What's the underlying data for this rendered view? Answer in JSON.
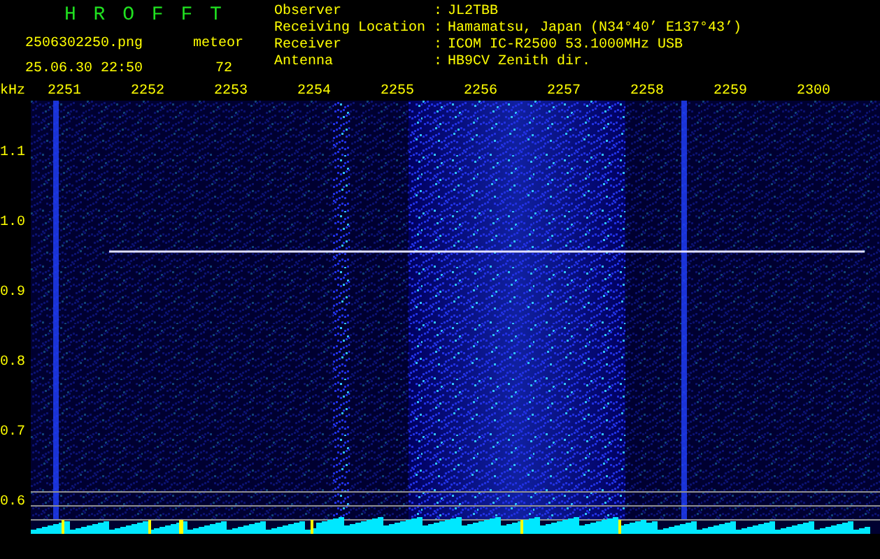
{
  "header": {
    "title": "H R O F F T",
    "filename": "2506302250.png",
    "datetime": "25.06.30 22:50",
    "count_label": "meteor",
    "count": "72"
  },
  "info": [
    {
      "label": "Observer",
      "separator": ":",
      "value": "JL2TBB"
    },
    {
      "label": "Receiving Location",
      "separator": ":",
      "value": "Hamamatsu, Japan (N34°40’ E137°43’)"
    },
    {
      "label": "Receiver",
      "separator": ":",
      "value": "ICOM IC-R2500 53.1000MHz USB"
    },
    {
      "label": "Antenna",
      "separator": ":",
      "value": "HB9CV Zenith dir."
    }
  ],
  "y_unit": "kHz",
  "x_labels": [
    "2251",
    "2252",
    "2253",
    "2254",
    "2255",
    "2256",
    "2257",
    "2258",
    "2259",
    "2300"
  ],
  "y_labels": [
    "1.1",
    "1.0",
    "0.9",
    "0.8",
    "0.7",
    "0.6"
  ]
}
